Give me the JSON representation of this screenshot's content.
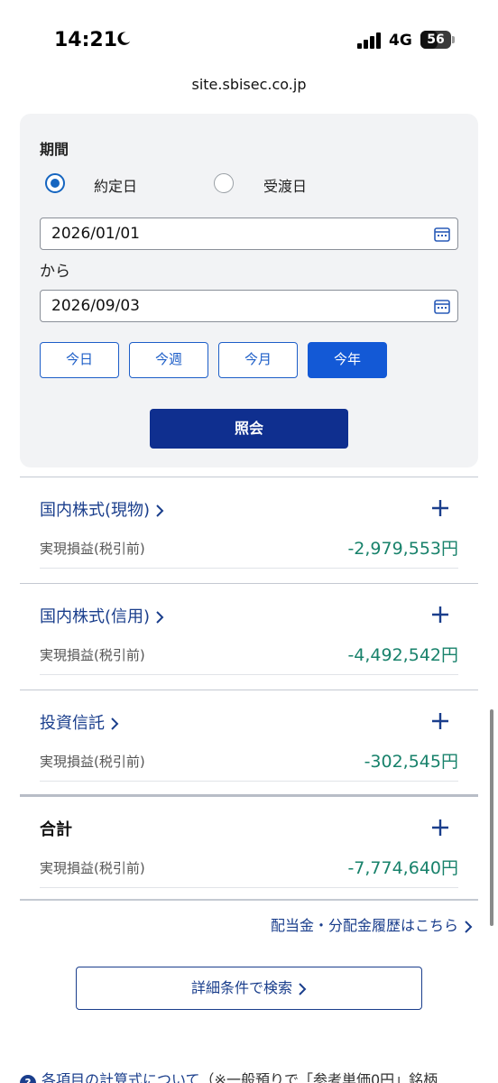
{
  "status": {
    "time": "14:21",
    "network": "4G",
    "battery": "56",
    "battery_level": 0.56
  },
  "browser": {
    "url": "site.sbisec.co.jp"
  },
  "search": {
    "period_label": "期間",
    "radio_trade_date": "約定日",
    "radio_delivery_date": "受渡日",
    "selected_radio": "約定日",
    "from_date": "2026/01/01",
    "from_label": "から",
    "to_date": "2026/09/03",
    "quick_buttons": [
      "今日",
      "今週",
      "今月",
      "今年"
    ],
    "active_quick_button": "今年",
    "submit_label": "照会"
  },
  "sections": [
    {
      "title": "国内株式(現物)",
      "row_label": "実現損益(税引前)",
      "value": "-2,979,553円"
    },
    {
      "title": "国内株式(信用)",
      "row_label": "実現損益(税引前)",
      "value": "-4,492,542円"
    },
    {
      "title": "投資信託",
      "row_label": "実現損益(税引前)",
      "value": "-302,545円"
    },
    {
      "title": "合計",
      "row_label": "実現損益(税引前)",
      "value": "-7,774,640円"
    }
  ],
  "links": {
    "dividend": "配当金・分配金履歴はこちら",
    "detail_search": "詳細条件で検索",
    "help_link": "各項目の計算式について",
    "help_rest": "（※一般預りで「参考単価0円」銘柄"
  },
  "colors": {
    "accent": "#1359d6",
    "navy": "#0f2f8f",
    "value_green": "#18826b",
    "link": "#1a3e8c"
  }
}
